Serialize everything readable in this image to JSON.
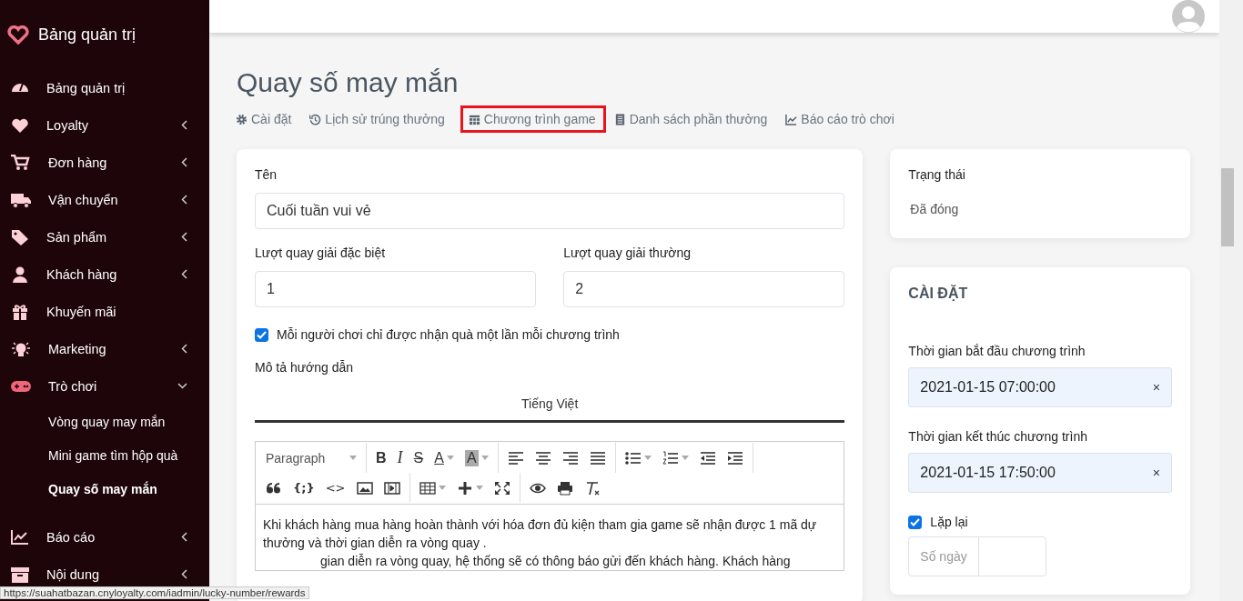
{
  "sidebar": {
    "brand": "Bảng quản trị",
    "items": [
      {
        "label": "Bảng quản trị",
        "kind": "link"
      },
      {
        "label": "Loyalty",
        "kind": "menu",
        "expanded": false
      },
      {
        "label": "Đơn hàng",
        "kind": "menu",
        "expanded": false
      },
      {
        "label": "Vận chuyển",
        "kind": "menu",
        "expanded": false
      },
      {
        "label": "Sản phẩm",
        "kind": "menu",
        "expanded": false
      },
      {
        "label": "Khách hàng",
        "kind": "menu",
        "expanded": false
      },
      {
        "label": "Khuyến mãi",
        "kind": "link"
      },
      {
        "label": "Marketing",
        "kind": "menu",
        "expanded": false
      },
      {
        "label": "Trò chơi",
        "kind": "menu",
        "expanded": true,
        "children": [
          {
            "label": "Vòng quay may mắn",
            "selected": false
          },
          {
            "label": "Mini game tìm hộp quà",
            "selected": false
          },
          {
            "label": "Quay số may mắn",
            "selected": true
          }
        ]
      },
      {
        "label": "Báo cáo",
        "kind": "menu",
        "expanded": false
      },
      {
        "label": "Nội dung",
        "kind": "menu",
        "expanded": false
      }
    ]
  },
  "page": {
    "title": "Quay số may mắn",
    "tabs": [
      {
        "label": "Cài đặt",
        "selected": false
      },
      {
        "label": "Lịch sử trúng thưởng",
        "selected": false
      },
      {
        "label": "Chương trình game",
        "selected": true
      },
      {
        "label": "Danh sách phần thưởng",
        "selected": false
      },
      {
        "label": "Báo cáo trò chơi",
        "selected": false
      }
    ]
  },
  "form": {
    "name_label": "Tên",
    "name_value": "Cuối tuần vui vẻ",
    "special_label": "Lượt quay giải đặc biệt",
    "special_value": "1",
    "normal_label": "Lượt quay giải thường",
    "normal_value": "2",
    "once_label": "Mỗi người chơi chỉ được nhận quà một lần mỗi chương trình",
    "once_checked": true,
    "desc_label": "Mô tả hướng dẫn",
    "languages": [
      {
        "label": "Tiếng Việt",
        "selected": true
      }
    ],
    "editor": {
      "format": "Paragraph",
      "glyphs": [
        "B",
        "I",
        "S",
        "A",
        "A",
        "{;}",
        "<>"
      ],
      "paragraphs": [
        "Khi khách hàng mua hàng hoàn thành với hóa đơn đủ kiện tham gia game sẽ nhận được 1 mã dự thưởng và thời gian diễn ra vòng quay .",
        "gian diễn ra vòng quay, hệ thống sẽ có thông báo gửi đến khách hàng. Khách hàng"
      ]
    }
  },
  "status": {
    "label": "Trạng thái",
    "value": "Đã đóng"
  },
  "settings": {
    "title": "CÀI ĐẶT",
    "start_label": "Thời gian bắt đầu chương trình",
    "start_value": "2021-01-15 07:00:00",
    "end_label": "Thời gian kết thúc chương trình",
    "end_value": "2021-01-15 17:50:00",
    "clear": "×",
    "repeat_label": "Lặp lại",
    "repeat_checked": true,
    "days_addon": "Số ngày"
  },
  "status_url": "https://suahatbazan.cnyloyalty.com/iadmin/lucky-number/rewards"
}
